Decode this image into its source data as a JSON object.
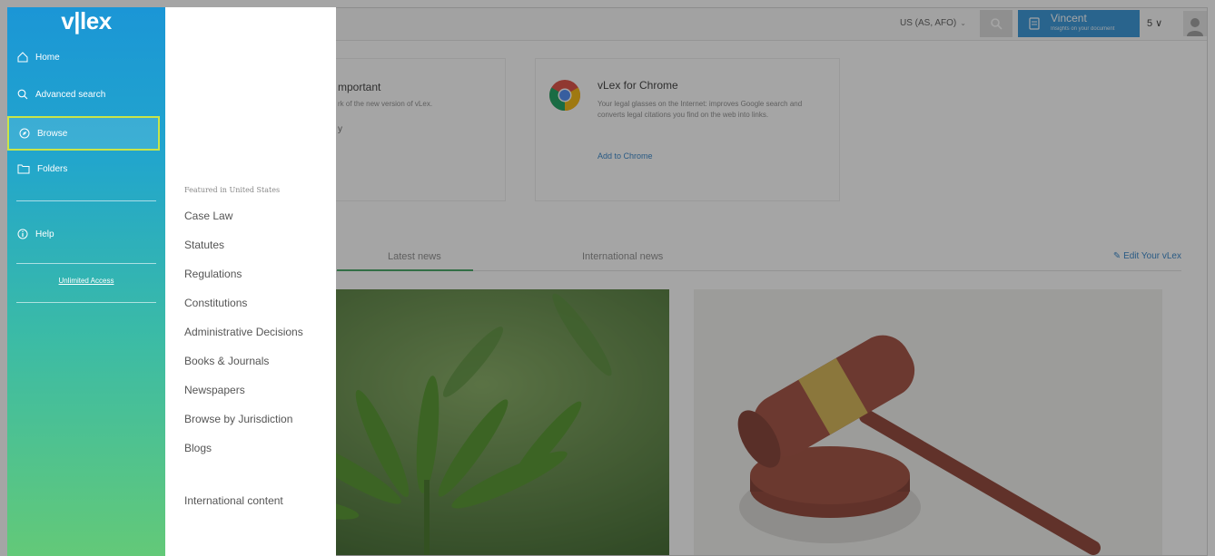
{
  "brand": {
    "logo_text": "v|lex"
  },
  "sidebar": {
    "items": [
      {
        "label": "Home",
        "icon": "home-icon"
      },
      {
        "label": "Advanced search",
        "icon": "search-icon"
      },
      {
        "label": "Browse",
        "icon": "compass-icon",
        "selected": true
      },
      {
        "label": "Folders",
        "icon": "folder-icon"
      },
      {
        "label": "Help",
        "icon": "info-icon"
      }
    ],
    "footer_link": "Unlimited Access"
  },
  "browse_panel": {
    "heading": "Featured in United States",
    "items": [
      "Case Law",
      "Statutes",
      "Regulations",
      "Constitutions",
      "Administrative Decisions",
      "Books & Journals",
      "Newspapers",
      "Browse by Jurisdiction",
      "Blogs"
    ],
    "extra": "International content"
  },
  "topbar": {
    "jurisdiction": "US (AS, AFO)",
    "user": {
      "name": "Vincent",
      "subtitle": "Insights on your document"
    },
    "counter": "5 ∨"
  },
  "cards": [
    {
      "title": "mportant",
      "text": "rk of the new version of vLex.",
      "link": "y"
    },
    {
      "title": "vLex for Chrome",
      "text": "Your legal glasses on the Internet: improves Google search and converts legal citations you find on the web into links.",
      "link": "Add to Chrome",
      "icon": "chrome-icon"
    }
  ],
  "tabs": {
    "items": [
      "Latest news",
      "International news"
    ],
    "edit_link": "Edit Your vLex"
  },
  "colors": {
    "sidebar_top": "#1b96d6",
    "sidebar_bottom": "#63c978",
    "selected_outline": "#c9e548",
    "user_box": "#2a8fd6"
  }
}
